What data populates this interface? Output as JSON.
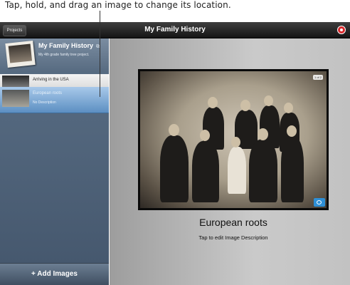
{
  "instruction": "Tap, hold, and drag an image to change its location.",
  "topbar": {
    "projects_label": "Projects",
    "title": "My Family History"
  },
  "sidebar": {
    "project": {
      "title": "My Family History",
      "subtitle": "My 4th grade family tree project."
    },
    "items": [
      {
        "title": "Arriving in the USA"
      },
      {
        "title": "European roots",
        "description": "No Description"
      }
    ],
    "add_images_label": "+ Add Images"
  },
  "main": {
    "image_counter": "1 of 2",
    "image_title": "European roots",
    "image_description": "Tap to edit Image Description"
  }
}
